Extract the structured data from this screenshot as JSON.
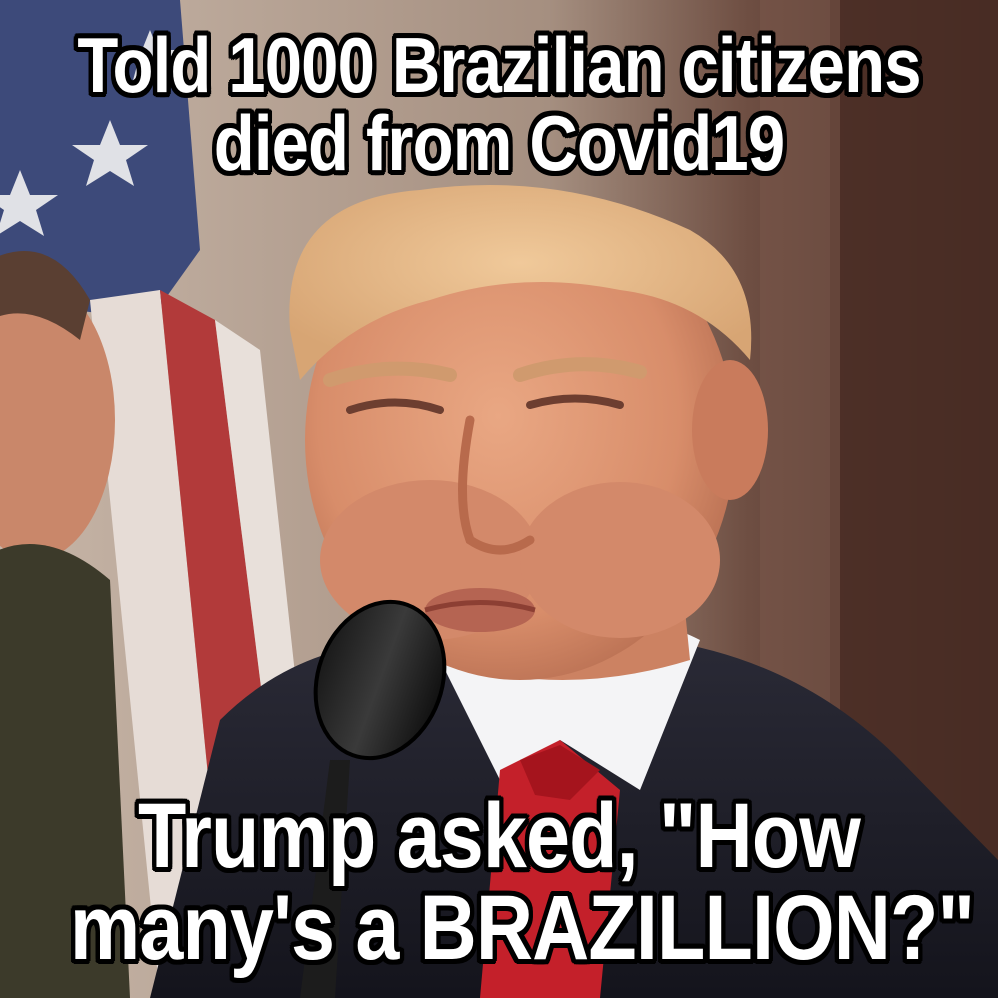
{
  "meme": {
    "top_caption": {
      "line1": "Told 1000 Brazilian citizens",
      "line2": "died from Covid19"
    },
    "bottom_caption": {
      "line1": "Trump asked, \"How",
      "line2": "many's a BRAZILLION?\""
    }
  }
}
